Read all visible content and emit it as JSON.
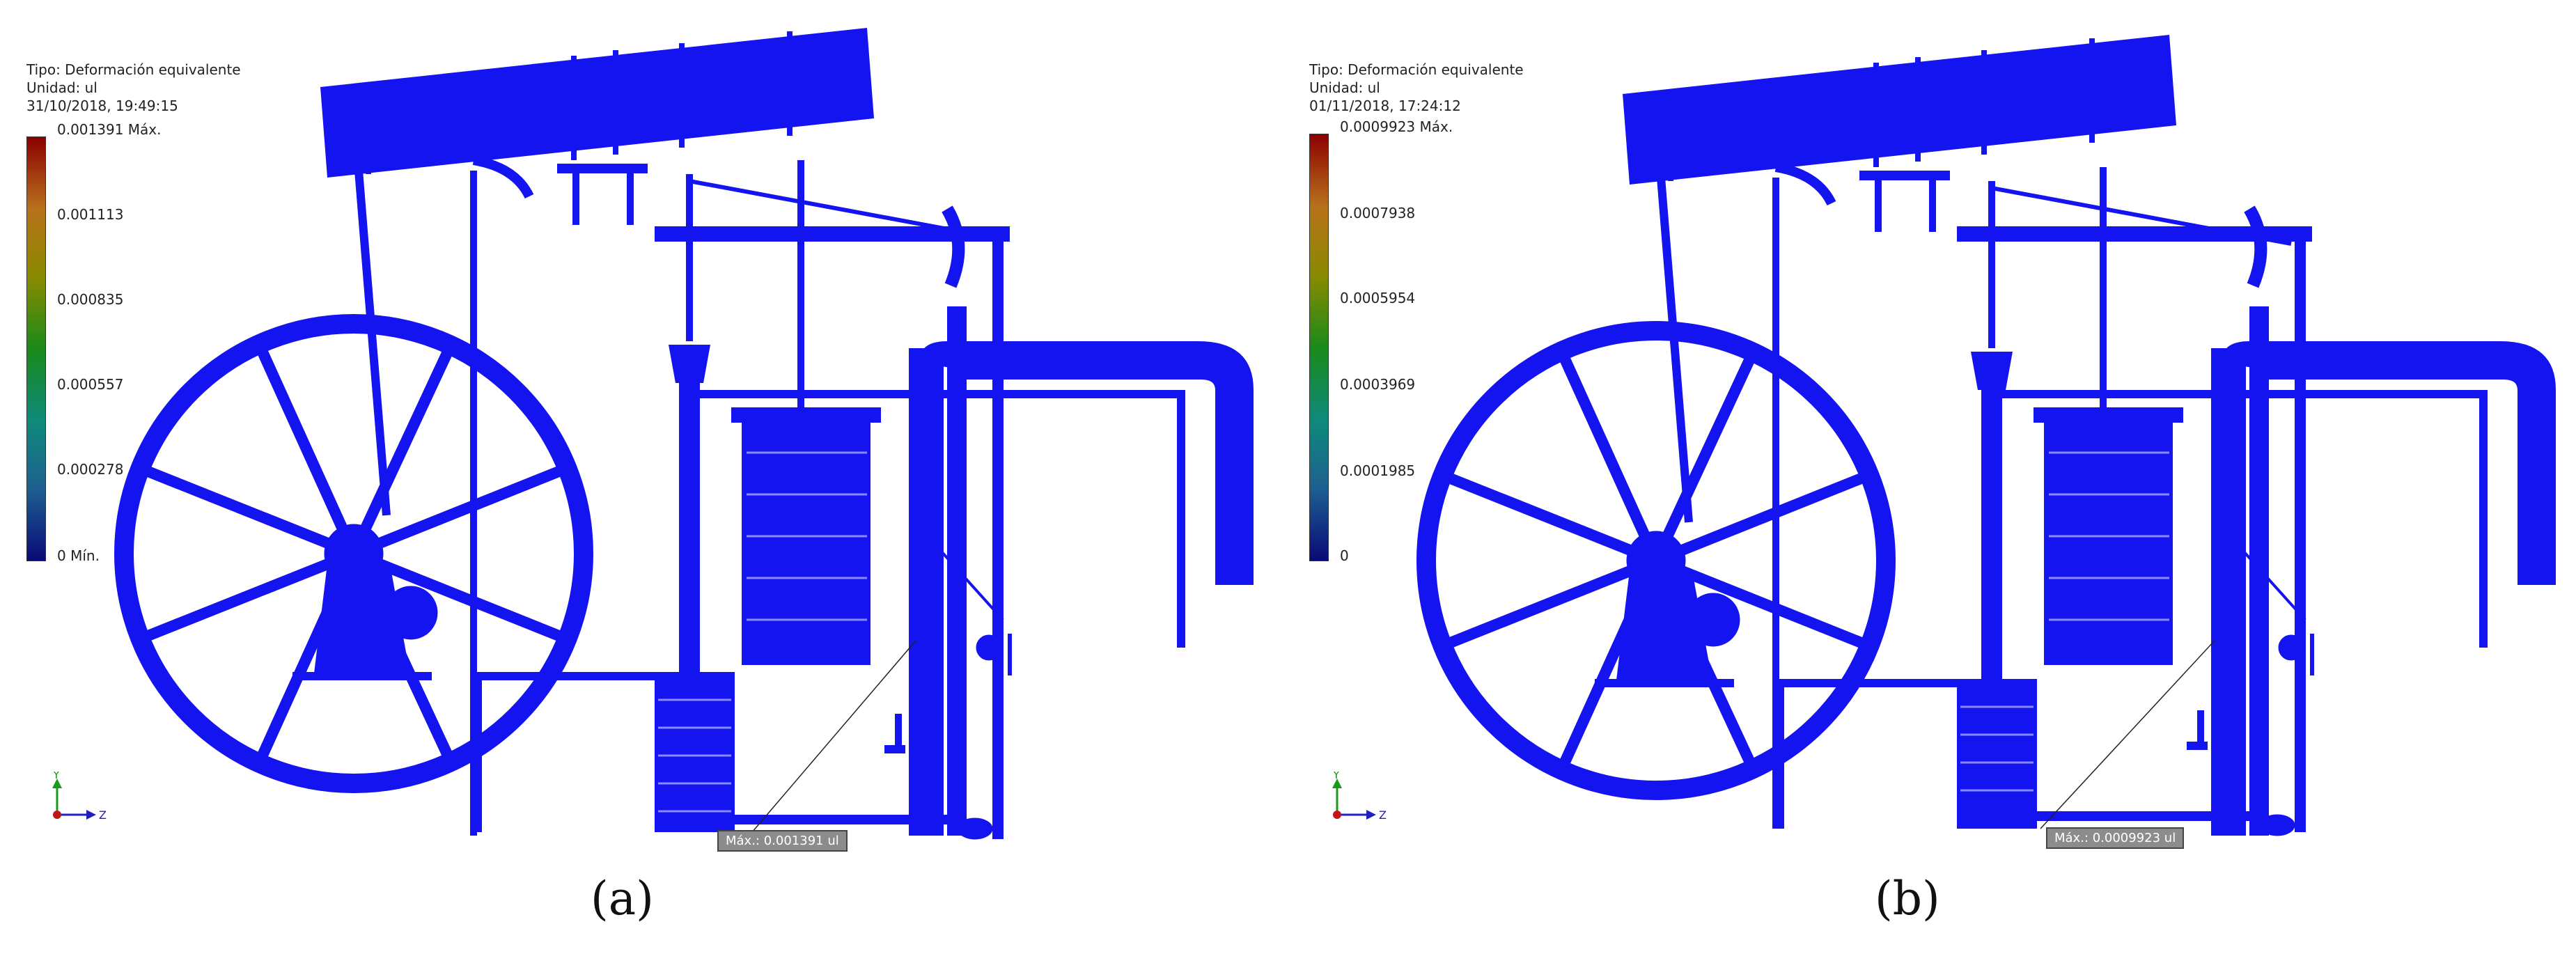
{
  "colors": {
    "model_blue": "#1414f0",
    "scale": [
      "#8b0000",
      "#b8721c",
      "#8a8a00",
      "#1a8a1a",
      "#0f8a7a",
      "#1d6090",
      "#0a0a78"
    ]
  },
  "panels": [
    {
      "type_label": "Tipo: Deformación equivalente",
      "unit_label": "Unidad: ul",
      "timestamp": "31/10/2018, 19:49:15",
      "ticks": [
        "0.001391 Máx.",
        "0.001113",
        "0.000835",
        "0.000557",
        "0.000278",
        "0 Mín."
      ],
      "max_label": "Máx.: 0.001391 ul",
      "caption": "(a)"
    },
    {
      "type_label": "Tipo: Deformación equivalente",
      "unit_label": "Unidad: ul",
      "timestamp": "01/11/2018, 17:24:12",
      "ticks": [
        "0.0009923 Máx.",
        "0.0007938",
        "0.0005954",
        "0.0003969",
        "0.0001985",
        "0"
      ],
      "max_label": "Máx.: 0.0009923 ul",
      "caption": "(b)"
    }
  ],
  "axes": {
    "y_label": "Y",
    "z_label": "Z"
  }
}
